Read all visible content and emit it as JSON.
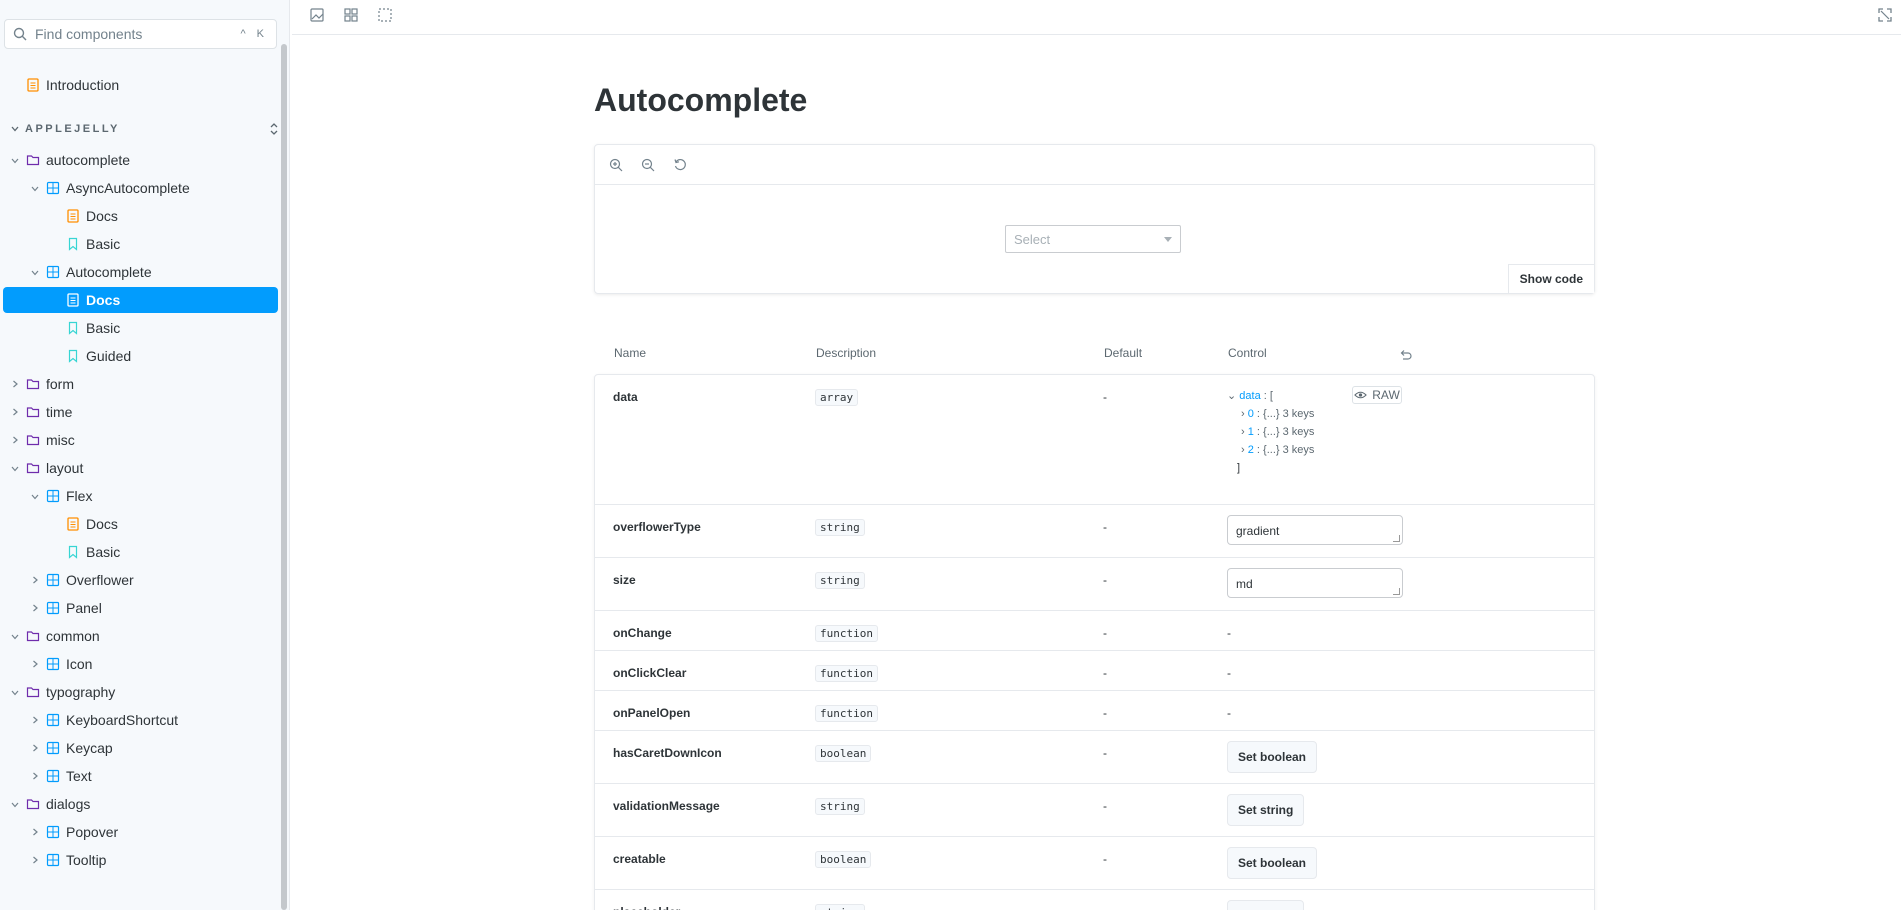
{
  "search": {
    "placeholder": "Find components",
    "shortcut": "^ K"
  },
  "sidebar": {
    "introduction": "Introduction",
    "section": "APPLEJELLY",
    "items": [
      {
        "label": "autocomplete",
        "kind": "folder",
        "expanded": true
      },
      {
        "label": "AsyncAutocomplete",
        "kind": "component",
        "expanded": true
      },
      {
        "label": "Docs",
        "kind": "docs"
      },
      {
        "label": "Basic",
        "kind": "story"
      },
      {
        "label": "Autocomplete",
        "kind": "component",
        "expanded": true
      },
      {
        "label": "Docs",
        "kind": "docs",
        "selected": true
      },
      {
        "label": "Basic",
        "kind": "story"
      },
      {
        "label": "Guided",
        "kind": "story"
      },
      {
        "label": "form",
        "kind": "folder",
        "expanded": false
      },
      {
        "label": "time",
        "kind": "folder",
        "expanded": false
      },
      {
        "label": "misc",
        "kind": "folder",
        "expanded": false
      },
      {
        "label": "layout",
        "kind": "folder",
        "expanded": true
      },
      {
        "label": "Flex",
        "kind": "component",
        "expanded": true
      },
      {
        "label": "Docs",
        "kind": "docs"
      },
      {
        "label": "Basic",
        "kind": "story"
      },
      {
        "label": "Overflower",
        "kind": "component",
        "expanded": false
      },
      {
        "label": "Panel",
        "kind": "component",
        "expanded": false
      },
      {
        "label": "common",
        "kind": "folder",
        "expanded": true
      },
      {
        "label": "Icon",
        "kind": "component",
        "expanded": false
      },
      {
        "label": "typography",
        "kind": "folder",
        "expanded": true
      },
      {
        "label": "KeyboardShortcut",
        "kind": "component",
        "expanded": false
      },
      {
        "label": "Keycap",
        "kind": "component",
        "expanded": false
      },
      {
        "label": "Text",
        "kind": "component",
        "expanded": false
      },
      {
        "label": "dialogs",
        "kind": "folder",
        "expanded": true
      },
      {
        "label": "Popover",
        "kind": "component",
        "expanded": false
      },
      {
        "label": "Tooltip",
        "kind": "component",
        "expanded": false
      }
    ]
  },
  "main": {
    "title": "Autocomplete",
    "preview": {
      "select_placeholder": "Select",
      "show_code": "Show code"
    },
    "table": {
      "headers": {
        "name": "Name",
        "description": "Description",
        "default": "Default",
        "control": "Control"
      },
      "raw_label": "RAW",
      "json": {
        "root": "data : [",
        "entries": [
          {
            "index": "0",
            "summary": "{...} 3 keys"
          },
          {
            "index": "1",
            "summary": "{...} 3 keys"
          },
          {
            "index": "2",
            "summary": "{...} 3 keys"
          }
        ],
        "close": "]"
      },
      "rows": [
        {
          "name": "data",
          "type": "array",
          "default": "-",
          "control": "json"
        },
        {
          "name": "overflowerType",
          "type": "string",
          "default": "-",
          "control": "text",
          "value": "gradient"
        },
        {
          "name": "size",
          "type": "string",
          "default": "-",
          "control": "text",
          "value": "md"
        },
        {
          "name": "onChange",
          "type": "function",
          "default": "-",
          "control": "dash",
          "value": "-"
        },
        {
          "name": "onClickClear",
          "type": "function",
          "default": "-",
          "control": "dash",
          "value": "-"
        },
        {
          "name": "onPanelOpen",
          "type": "function",
          "default": "-",
          "control": "dash",
          "value": "-"
        },
        {
          "name": "hasCaretDownIcon",
          "type": "boolean",
          "default": "-",
          "control": "button",
          "value": "Set boolean"
        },
        {
          "name": "validationMessage",
          "type": "string",
          "default": "-",
          "control": "button",
          "value": "Set string"
        },
        {
          "name": "creatable",
          "type": "boolean",
          "default": "-",
          "control": "button",
          "value": "Set boolean"
        },
        {
          "name": "placeholder",
          "type": "string",
          "default": "-",
          "control": "button",
          "value": "Set string"
        }
      ]
    }
  },
  "colors": {
    "accent": "#029cfd",
    "docs_icon": "#ff8f00",
    "story_icon": "#37d5d3",
    "component_icon": "#029cfd",
    "folder_icon": "#6f2cac"
  }
}
